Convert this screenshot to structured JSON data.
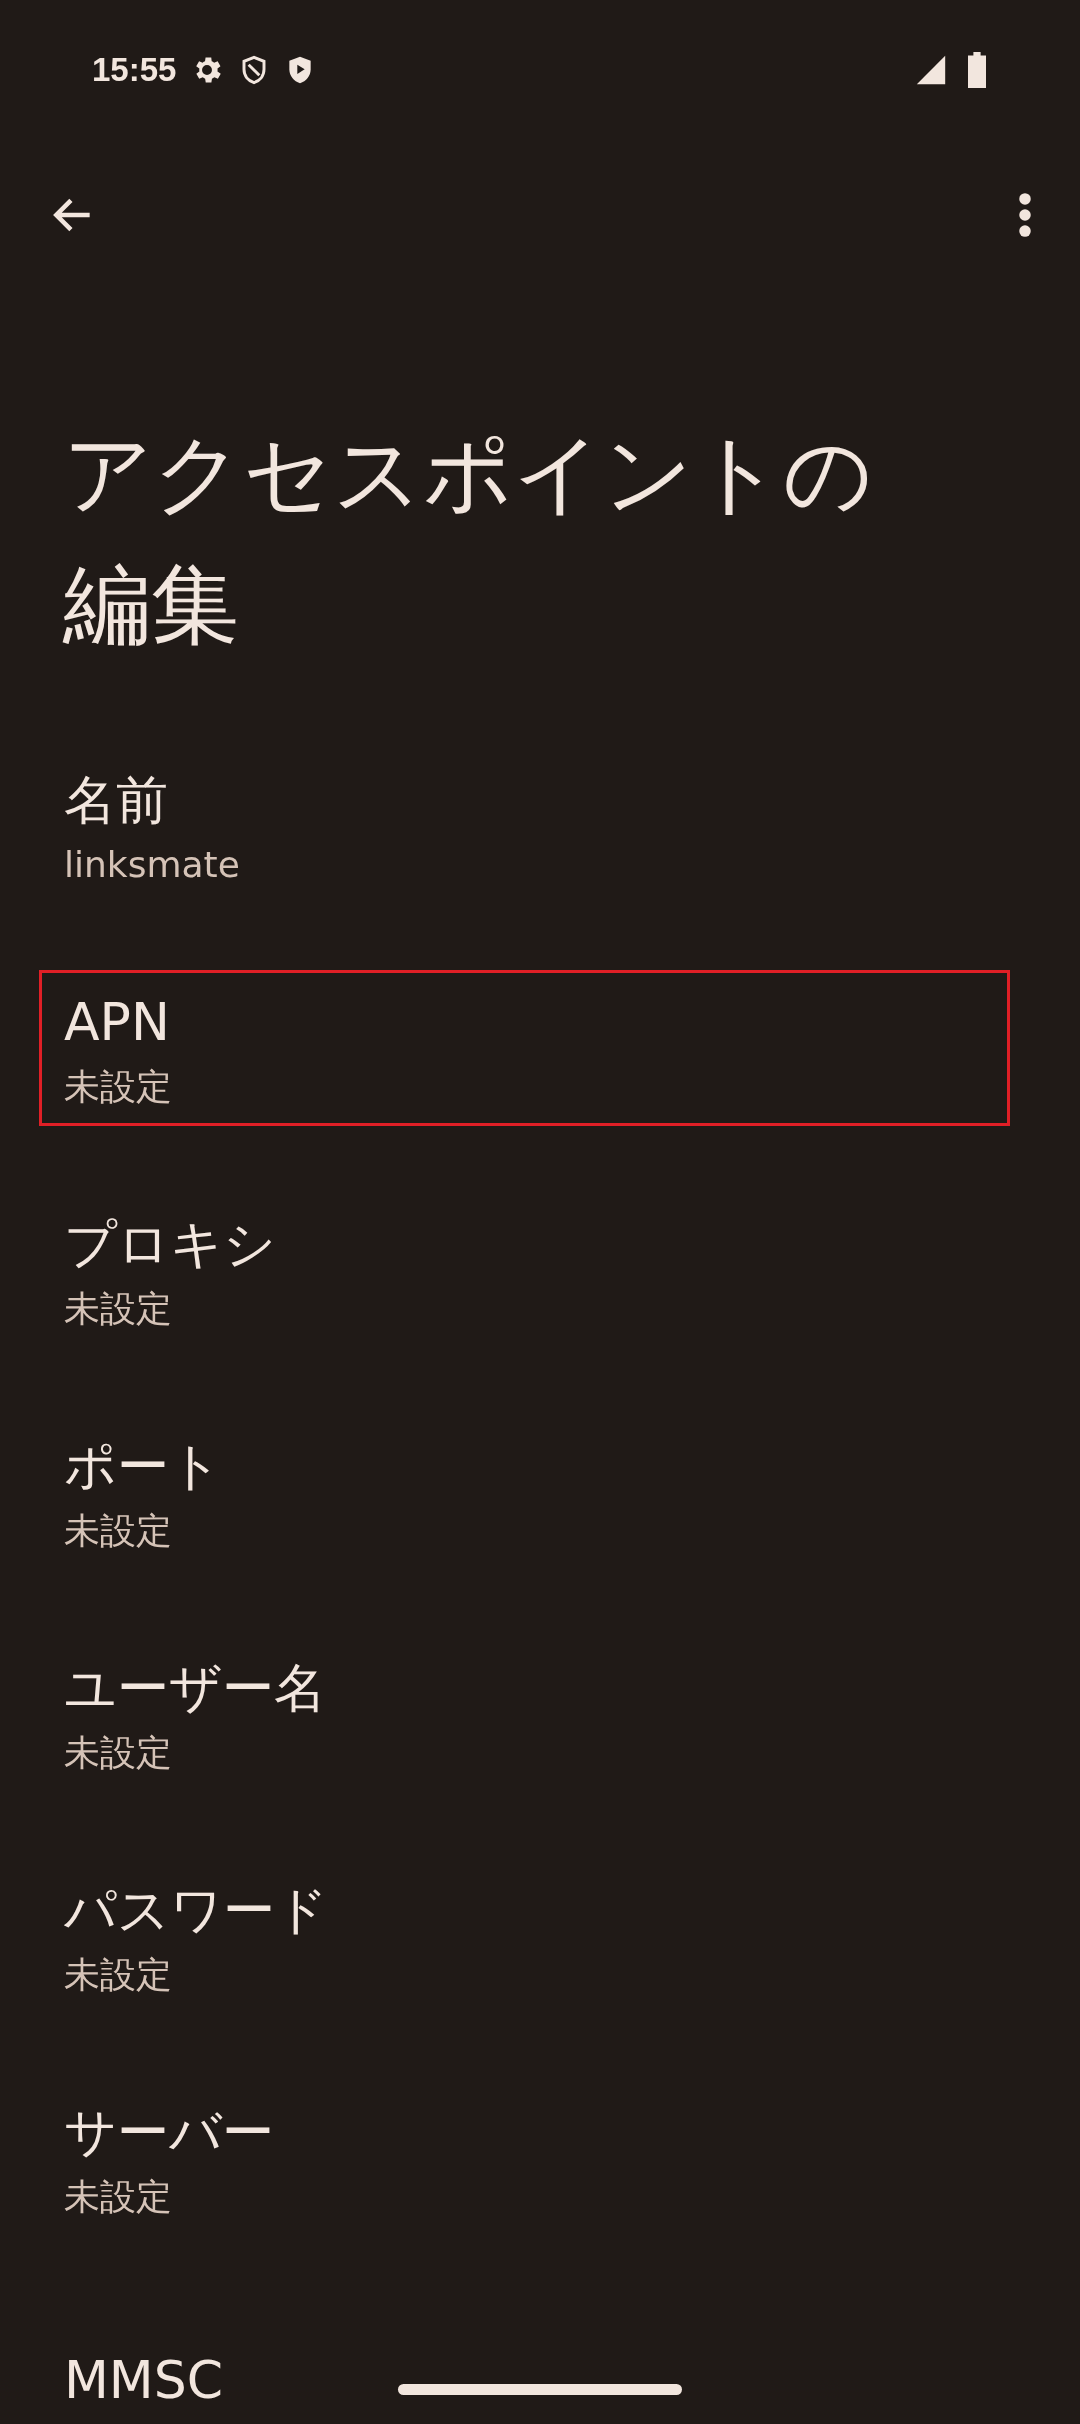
{
  "status_bar": {
    "time": "15:55"
  },
  "title": "アクセスポイントの編集",
  "items": [
    {
      "label": "名前",
      "value": "linksmate",
      "highlighted": false
    },
    {
      "label": "APN",
      "value": "未設定",
      "highlighted": true
    },
    {
      "label": "プロキシ",
      "value": "未設定",
      "highlighted": false
    },
    {
      "label": "ポート",
      "value": "未設定",
      "highlighted": false
    },
    {
      "label": "ユーザー名",
      "value": "未設定",
      "highlighted": false
    },
    {
      "label": "パスワード",
      "value": "未設定",
      "highlighted": false
    },
    {
      "label": "サーバー",
      "value": "未設定",
      "highlighted": false
    },
    {
      "label": "MMSC",
      "highlighted": false
    }
  ]
}
